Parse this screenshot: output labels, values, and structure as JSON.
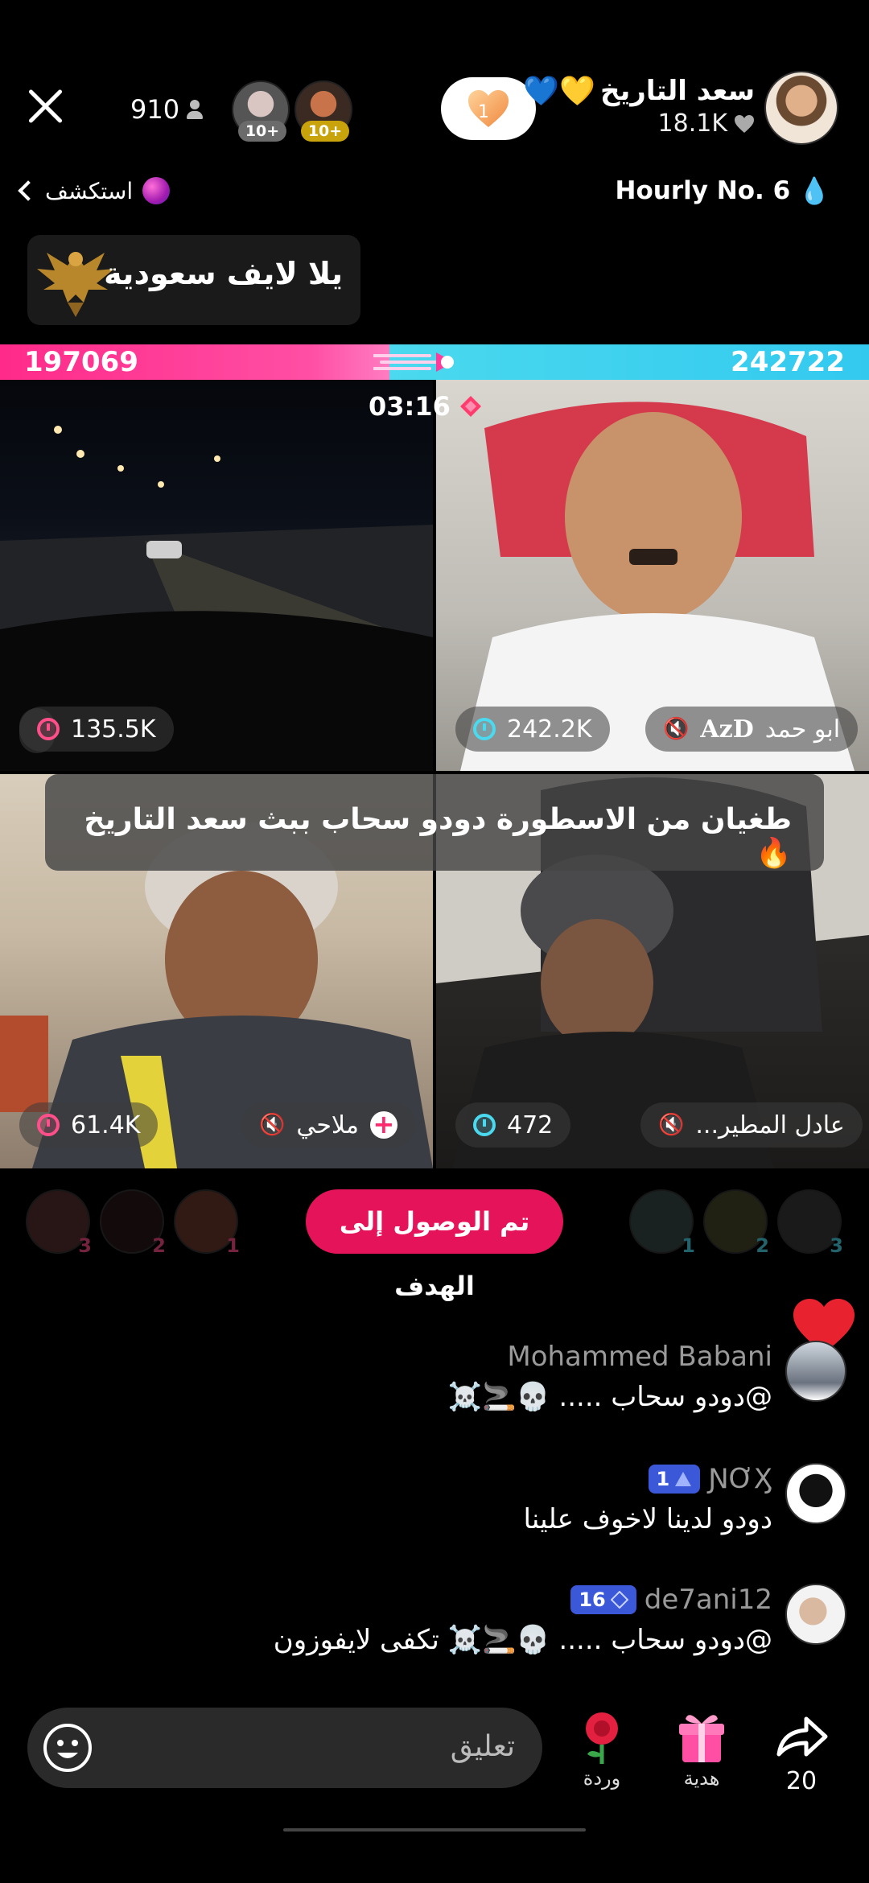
{
  "header": {
    "viewer_count": "910",
    "top_viewer_badges": [
      "10+",
      "10+"
    ],
    "follow_count": "1",
    "host_name": "سعد التاريخ",
    "host_name_hearts": "💙💛",
    "host_likes": "18.1K",
    "explore_label": "استكشف",
    "hourly_rank": "Hourly No. 6",
    "hourly_icon": "💧"
  },
  "pinned": {
    "title": "يلا لايف سعودية"
  },
  "battle": {
    "left_score": "197069",
    "right_score": "242722",
    "timer": "03:16",
    "left_share": 0.448,
    "left_color": "#ff2a8a",
    "right_color": "#36cdef"
  },
  "guests": [
    {
      "position": "top-left",
      "score": "135.5K",
      "name": ""
    },
    {
      "position": "top-right",
      "score": "242.2K",
      "name": "ابو حمد",
      "tag": "AzD"
    },
    {
      "position": "bottom-left",
      "score": "61.4K",
      "name": "ملاحي"
    },
    {
      "position": "bottom-right",
      "score": "472",
      "name": "عادل المطير..."
    }
  ],
  "overlay_banner": {
    "text": "طغيان من الاسطورة دودو سحاب ببث سعد التاريخ",
    "emoji": "🔥"
  },
  "top_fans": {
    "left": [
      "3",
      "2",
      "1"
    ],
    "right": [
      "1",
      "2",
      "3"
    ]
  },
  "goal_button": "تم الوصول إلى الهدف",
  "comments": [
    {
      "name": "Mohammed Babani",
      "level": "",
      "text": "@دودو سحاب ..... 💀🚬☠️"
    },
    {
      "name": "ƝƠӼ",
      "level": "1",
      "text": "دودو لدينا لاخوف علينا"
    },
    {
      "name": "de7ani12",
      "level": "16",
      "text": "@دودو سحاب ..... 💀🚬☠️ تكفى لايفوزون"
    }
  ],
  "bottom": {
    "comment_placeholder": "تعليق",
    "rose_label": "وردة",
    "gift_label": "هدية",
    "share_count": "20"
  },
  "colors": {
    "accent_pink": "#e5145a",
    "level_blue": "#3b58d9"
  },
  "icons": [
    "close-icon",
    "person-icon",
    "heart-icon",
    "planet-icon",
    "fire-icon",
    "alarm-icon",
    "mute-icon",
    "plus-icon",
    "smile-icon",
    "rose-icon",
    "gift-icon",
    "share-icon",
    "chevron-left-icon"
  ]
}
